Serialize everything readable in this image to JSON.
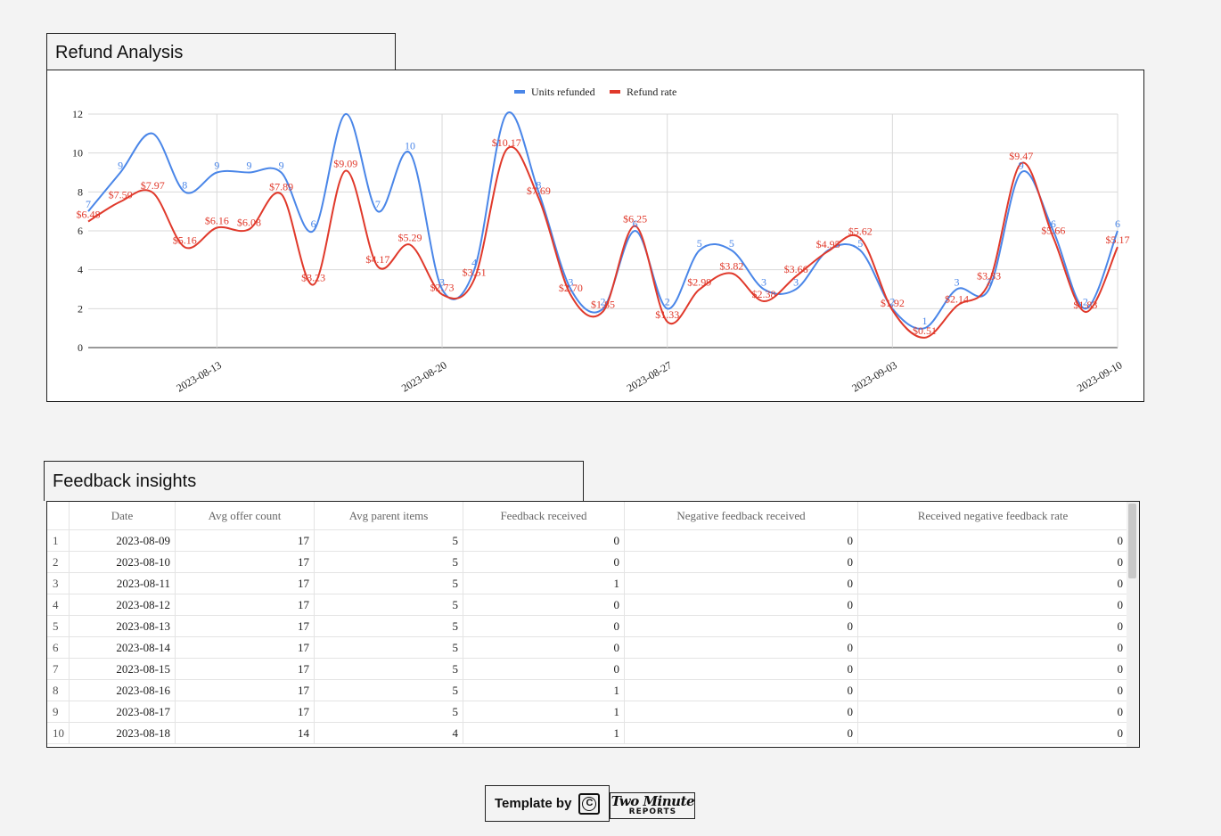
{
  "refund_section": {
    "title": "Refund Analysis"
  },
  "feedback_section": {
    "title": "Feedback insights"
  },
  "footer": {
    "template_by": "Template by",
    "brand_line1": "Two Minute",
    "brand_line2": "REPORTS",
    "icon": "copyright-icon"
  },
  "colors": {
    "units": "#4a86e8",
    "rate": "#e0392b",
    "grid": "#d9d9d9"
  },
  "chart_data": {
    "type": "line",
    "smooth": true,
    "legend": {
      "position": "top-center"
    },
    "grid": true,
    "ylim": [
      0,
      12
    ],
    "yticks": [
      0,
      2,
      4,
      6,
      8,
      10,
      12
    ],
    "x_start": "2023-08-09",
    "x_end": "2023-09-10",
    "xticks": [
      "2023-08-13",
      "2023-08-20",
      "2023-08-27",
      "2023-09-03",
      "2023-09-10"
    ],
    "series": [
      {
        "name": "Units refunded",
        "color": "#4a86e8",
        "values": [
          7,
          9,
          11,
          8,
          9,
          9,
          9,
          6,
          12,
          7,
          10,
          3,
          4,
          12,
          8,
          3,
          2,
          6,
          2,
          5,
          5,
          3,
          3,
          5,
          5,
          2,
          1,
          3,
          3,
          9,
          6,
          2,
          6
        ],
        "labels": [
          "7",
          "9",
          "",
          "8",
          "9",
          "9",
          "9",
          "6",
          "",
          "7",
          "10",
          "3",
          "4",
          "",
          "8",
          "3",
          "2",
          "6",
          "2",
          "5",
          "5",
          "3",
          "3",
          "",
          "5",
          "2",
          "1",
          "3",
          "3",
          "9",
          "6",
          "2",
          "6"
        ]
      },
      {
        "name": "Refund rate",
        "color": "#e0392b",
        "values": [
          6.48,
          7.5,
          7.97,
          5.16,
          6.16,
          6.08,
          7.89,
          3.23,
          9.09,
          4.17,
          5.29,
          2.73,
          3.51,
          10.17,
          7.69,
          2.7,
          1.85,
          6.25,
          1.33,
          2.99,
          3.82,
          2.38,
          3.66,
          4.95,
          5.62,
          1.92,
          0.51,
          2.14,
          3.33,
          9.47,
          5.66,
          1.83,
          5.17
        ],
        "labels": [
          "$6.48",
          "$7.50",
          "$7.97",
          "$5.16",
          "$6.16",
          "$6.08",
          "$7.89",
          "$3.23",
          "$9.09",
          "$4.17",
          "$5.29",
          "$2.73",
          "$3.51",
          "$10.17",
          "$7.69",
          "$2.70",
          "$1.85",
          "$6.25",
          "$1.33",
          "$2.99",
          "$3.82",
          "$2.38",
          "$3.66",
          "$4.95",
          "$5.62",
          "$1.92",
          "$0.51",
          "$2.14",
          "$3.33",
          "$9.47",
          "$5.66",
          "$1.83",
          "$5.17"
        ]
      }
    ]
  },
  "table": {
    "columns": [
      "",
      "Date",
      "Avg offer count",
      "Avg parent items",
      "Feedback received",
      "Negative feedback received",
      "Received negative feedback rate"
    ],
    "rows": [
      [
        "1",
        "2023-08-09",
        "17",
        "5",
        "0",
        "0",
        "0"
      ],
      [
        "2",
        "2023-08-10",
        "17",
        "5",
        "0",
        "0",
        "0"
      ],
      [
        "3",
        "2023-08-11",
        "17",
        "5",
        "1",
        "0",
        "0"
      ],
      [
        "4",
        "2023-08-12",
        "17",
        "5",
        "0",
        "0",
        "0"
      ],
      [
        "5",
        "2023-08-13",
        "17",
        "5",
        "0",
        "0",
        "0"
      ],
      [
        "6",
        "2023-08-14",
        "17",
        "5",
        "0",
        "0",
        "0"
      ],
      [
        "7",
        "2023-08-15",
        "17",
        "5",
        "0",
        "0",
        "0"
      ],
      [
        "8",
        "2023-08-16",
        "17",
        "5",
        "1",
        "0",
        "0"
      ],
      [
        "9",
        "2023-08-17",
        "17",
        "5",
        "1",
        "0",
        "0"
      ],
      [
        "10",
        "2023-08-18",
        "14",
        "4",
        "1",
        "0",
        "0"
      ]
    ]
  }
}
